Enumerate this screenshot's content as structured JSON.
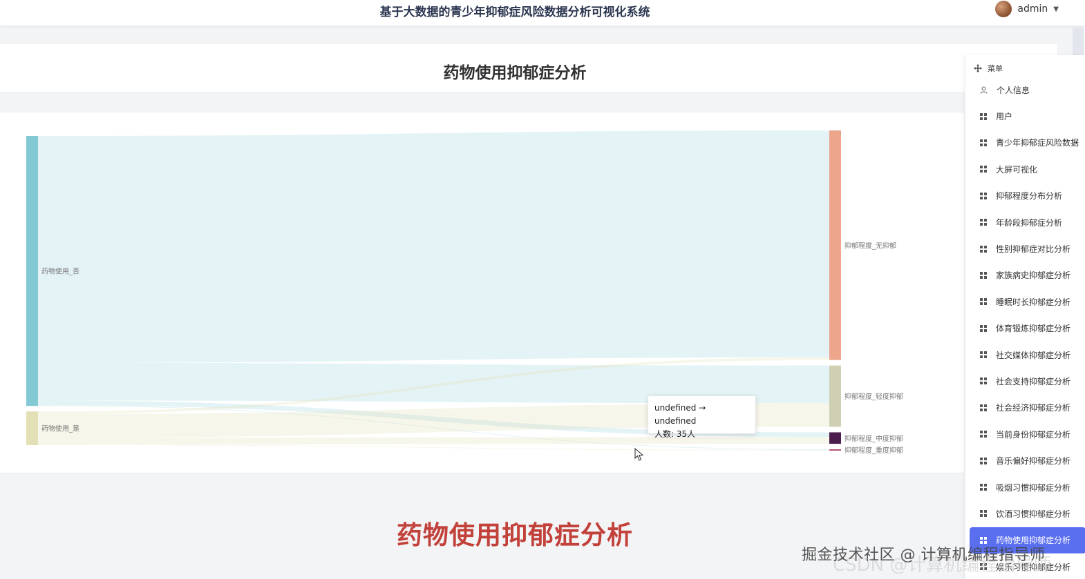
{
  "header": {
    "title": "基于大数据的青少年抑郁症风险数据分析可视化系统",
    "username": "admin"
  },
  "page": {
    "title": "药物使用抑郁症分析",
    "caption": "药物使用抑郁症分析"
  },
  "sidebar": {
    "header_label": "菜单",
    "items": [
      {
        "label": "个人信息",
        "icon": "user-icon"
      },
      {
        "label": "用户",
        "icon": "grid-icon"
      },
      {
        "label": "青少年抑郁症风险数据",
        "icon": "grid-icon"
      },
      {
        "label": "大屏可视化",
        "icon": "grid-icon"
      },
      {
        "label": "抑郁程度分布分析",
        "icon": "grid-icon"
      },
      {
        "label": "年龄段抑郁症分析",
        "icon": "grid-icon"
      },
      {
        "label": "性别抑郁症对比分析",
        "icon": "grid-icon"
      },
      {
        "label": "家族病史抑郁症分析",
        "icon": "grid-icon"
      },
      {
        "label": "睡眠时长抑郁症分析",
        "icon": "grid-icon"
      },
      {
        "label": "体育锻炼抑郁症分析",
        "icon": "grid-icon"
      },
      {
        "label": "社交媒体抑郁症分析",
        "icon": "grid-icon"
      },
      {
        "label": "社会支持抑郁症分析",
        "icon": "grid-icon"
      },
      {
        "label": "社会经济抑郁症分析",
        "icon": "grid-icon"
      },
      {
        "label": "当前身份抑郁症分析",
        "icon": "grid-icon"
      },
      {
        "label": "音乐偏好抑郁症分析",
        "icon": "grid-icon"
      },
      {
        "label": "吸烟习惯抑郁症分析",
        "icon": "grid-icon"
      },
      {
        "label": "饮酒习惯抑郁症分析",
        "icon": "grid-icon"
      },
      {
        "label": "药物使用抑郁症分析",
        "icon": "grid-icon",
        "active": true
      },
      {
        "label": "娱乐习惯抑郁症分析",
        "icon": "grid-icon"
      }
    ]
  },
  "tooltip": {
    "line1": "undefined → undefined",
    "line2": "人数: 35人"
  },
  "watermark": {
    "text": "掘金技术社区 @ 计算机编程指导师",
    "csdn": "CSDN @计算机编程指导师"
  },
  "colors": {
    "accent": "#5a6ff0",
    "caption": "#c2413a"
  },
  "chart_data": {
    "type": "sankey",
    "nodes": [
      {
        "name": "药物使用_否",
        "side": "source",
        "color": "#82c9d4"
      },
      {
        "name": "药物使用_是",
        "side": "source",
        "color": "#e3e0b5"
      },
      {
        "name": "抑郁程度_无抑郁",
        "side": "target",
        "color": "#eda58c"
      },
      {
        "name": "抑郁程度_轻度抑郁",
        "side": "target",
        "color": "#cfcfb3"
      },
      {
        "name": "抑郁程度_中度抑郁",
        "side": "target",
        "color": "#4a1d4c"
      },
      {
        "name": "抑郁程度_重度抑郁",
        "side": "target",
        "color": "#b34f76"
      }
    ],
    "links": [
      {
        "source": "药物使用_否",
        "target": "抑郁程度_无抑郁",
        "value": 337
      },
      {
        "source": "药物使用_否",
        "target": "抑郁程度_轻度抑郁",
        "value": 56
      },
      {
        "source": "药物使用_否",
        "target": "抑郁程度_中度抑郁",
        "value": 7
      },
      {
        "source": "药物使用_否",
        "target": "抑郁程度_重度抑郁",
        "value": 1
      },
      {
        "source": "药物使用_是",
        "target": "抑郁程度_无抑郁",
        "value": 4
      },
      {
        "source": "药物使用_是",
        "target": "抑郁程度_轻度抑郁",
        "value": 35
      },
      {
        "source": "药物使用_是",
        "target": "抑郁程度_中度抑郁",
        "value": 10
      },
      {
        "source": "药物使用_是",
        "target": "抑郁程度_重度抑郁",
        "value": 1
      }
    ],
    "tooltip_value": 35
  }
}
